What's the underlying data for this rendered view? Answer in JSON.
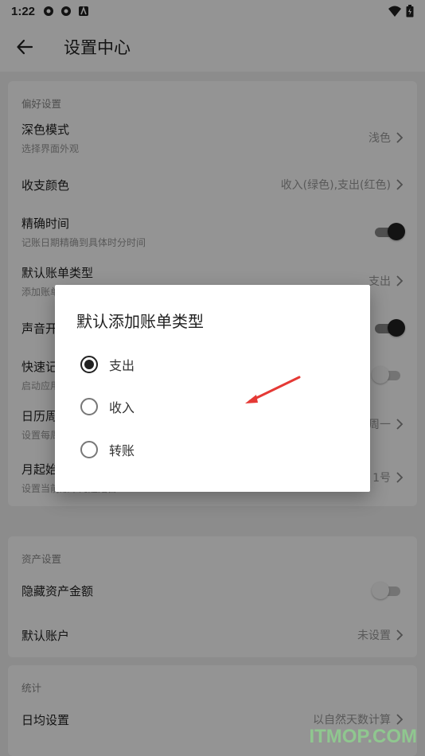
{
  "status_bar": {
    "time": "1:22"
  },
  "app_bar": {
    "title": "设置中心"
  },
  "preferences": {
    "section_title": "偏好设置",
    "dark_mode": {
      "label": "深色模式",
      "sub": "选择界面外观",
      "value": "浅色"
    },
    "color": {
      "label": "收支颜色",
      "value": "收入(绿色),支出(红色)"
    },
    "precise_time": {
      "label": "精确时间",
      "sub": "记账日期精确到具体时分时间",
      "toggle": "on"
    },
    "default_type": {
      "label": "默认账单类型",
      "sub": "添加账单默认类型",
      "value": "支出"
    },
    "sound": {
      "label": "声音开关",
      "toggle": "on"
    },
    "quick": {
      "label": "快速记账",
      "sub": "启动应用时直接进入记账",
      "toggle": "off"
    },
    "week_start": {
      "label": "日历周起始日",
      "sub": "设置每周的起始日",
      "value": "周一"
    },
    "month_start": {
      "label": "月起始日",
      "sub": "设置当前账本的起始日",
      "value": "1号"
    }
  },
  "assets": {
    "section_title": "资产设置",
    "hide_amount": {
      "label": "隐藏资产金额",
      "toggle": "off"
    },
    "default_account": {
      "label": "默认账户",
      "value": "未设置"
    }
  },
  "stats": {
    "section_title": "统计",
    "daily_avg": {
      "label": "日均设置",
      "value": "以自然天数计算"
    }
  },
  "dialog": {
    "title": "默认添加账单类型",
    "options": [
      {
        "label": "支出",
        "checked": true
      },
      {
        "label": "收入",
        "checked": false
      },
      {
        "label": "转账",
        "checked": false
      }
    ]
  },
  "annotation": {
    "color": "#e53935"
  },
  "watermark": "ITMOP.COM"
}
